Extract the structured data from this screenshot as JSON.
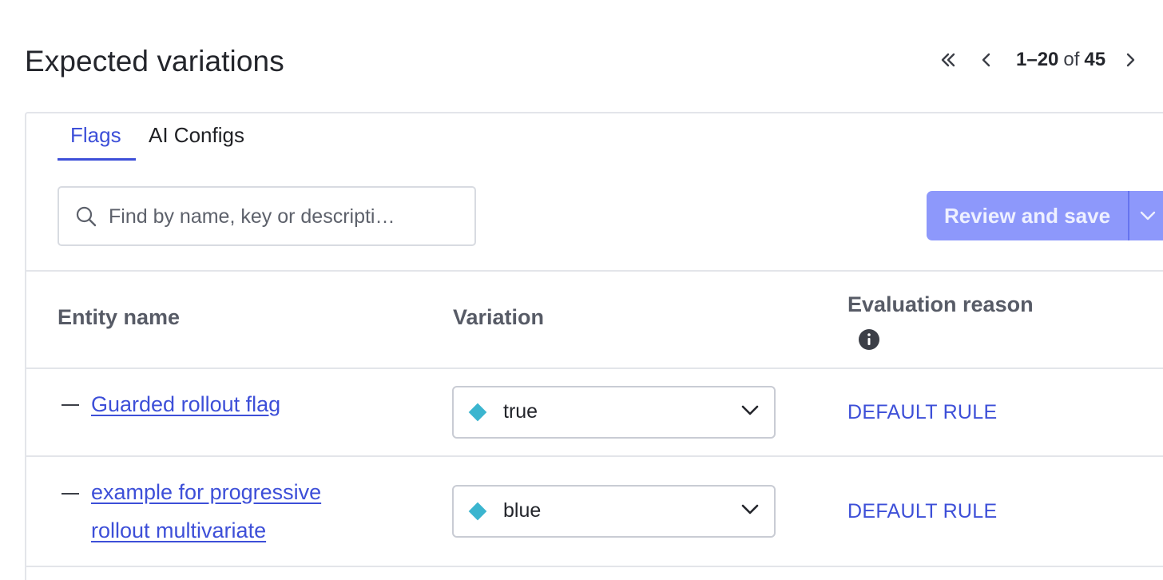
{
  "page": {
    "title": "Expected variations"
  },
  "pagination": {
    "range": "1–20",
    "of": "of",
    "total": "45"
  },
  "tabs": [
    {
      "label": "Flags",
      "active": true
    },
    {
      "label": "AI Configs",
      "active": false
    }
  ],
  "search": {
    "placeholder": "Find by name, key or descripti…",
    "value": ""
  },
  "actions": {
    "review_save_label": "Review and save"
  },
  "table": {
    "columns": [
      "Entity name",
      "Variation",
      "Evaluation reason"
    ],
    "rows": [
      {
        "name": "Guarded rollout flag",
        "variation": "true",
        "reason": "DEFAULT RULE"
      },
      {
        "name_line1": "example for progressive",
        "name_line2": "rollout multivariate",
        "variation": "blue",
        "reason": "DEFAULT RULE"
      }
    ]
  },
  "colors": {
    "accent": "#3d4fd8",
    "button_disabled": "#8d98fb",
    "variation_diamond": "#3bb5cf"
  },
  "icons": [
    "first-page-icon",
    "previous-page-icon",
    "next-page-icon",
    "search-icon",
    "chevron-down-icon",
    "info-icon"
  ]
}
